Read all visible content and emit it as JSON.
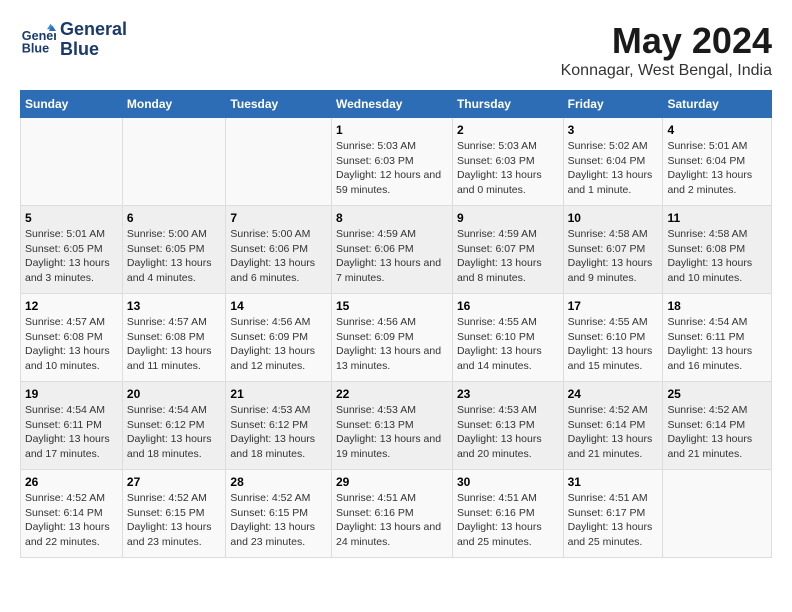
{
  "header": {
    "logo_line1": "General",
    "logo_line2": "Blue",
    "title": "May 2024",
    "subtitle": "Konnagar, West Bengal, India"
  },
  "weekdays": [
    "Sunday",
    "Monday",
    "Tuesday",
    "Wednesday",
    "Thursday",
    "Friday",
    "Saturday"
  ],
  "weeks": [
    [
      {
        "day": "",
        "info": ""
      },
      {
        "day": "",
        "info": ""
      },
      {
        "day": "",
        "info": ""
      },
      {
        "day": "1",
        "info": "Sunrise: 5:03 AM\nSunset: 6:03 PM\nDaylight: 12 hours\nand 59 minutes."
      },
      {
        "day": "2",
        "info": "Sunrise: 5:03 AM\nSunset: 6:03 PM\nDaylight: 13 hours\nand 0 minutes."
      },
      {
        "day": "3",
        "info": "Sunrise: 5:02 AM\nSunset: 6:04 PM\nDaylight: 13 hours\nand 1 minute."
      },
      {
        "day": "4",
        "info": "Sunrise: 5:01 AM\nSunset: 6:04 PM\nDaylight: 13 hours\nand 2 minutes."
      }
    ],
    [
      {
        "day": "5",
        "info": "Sunrise: 5:01 AM\nSunset: 6:05 PM\nDaylight: 13 hours\nand 3 minutes."
      },
      {
        "day": "6",
        "info": "Sunrise: 5:00 AM\nSunset: 6:05 PM\nDaylight: 13 hours\nand 4 minutes."
      },
      {
        "day": "7",
        "info": "Sunrise: 5:00 AM\nSunset: 6:06 PM\nDaylight: 13 hours\nand 6 minutes."
      },
      {
        "day": "8",
        "info": "Sunrise: 4:59 AM\nSunset: 6:06 PM\nDaylight: 13 hours\nand 7 minutes."
      },
      {
        "day": "9",
        "info": "Sunrise: 4:59 AM\nSunset: 6:07 PM\nDaylight: 13 hours\nand 8 minutes."
      },
      {
        "day": "10",
        "info": "Sunrise: 4:58 AM\nSunset: 6:07 PM\nDaylight: 13 hours\nand 9 minutes."
      },
      {
        "day": "11",
        "info": "Sunrise: 4:58 AM\nSunset: 6:08 PM\nDaylight: 13 hours\nand 10 minutes."
      }
    ],
    [
      {
        "day": "12",
        "info": "Sunrise: 4:57 AM\nSunset: 6:08 PM\nDaylight: 13 hours\nand 10 minutes."
      },
      {
        "day": "13",
        "info": "Sunrise: 4:57 AM\nSunset: 6:08 PM\nDaylight: 13 hours\nand 11 minutes."
      },
      {
        "day": "14",
        "info": "Sunrise: 4:56 AM\nSunset: 6:09 PM\nDaylight: 13 hours\nand 12 minutes."
      },
      {
        "day": "15",
        "info": "Sunrise: 4:56 AM\nSunset: 6:09 PM\nDaylight: 13 hours\nand 13 minutes."
      },
      {
        "day": "16",
        "info": "Sunrise: 4:55 AM\nSunset: 6:10 PM\nDaylight: 13 hours\nand 14 minutes."
      },
      {
        "day": "17",
        "info": "Sunrise: 4:55 AM\nSunset: 6:10 PM\nDaylight: 13 hours\nand 15 minutes."
      },
      {
        "day": "18",
        "info": "Sunrise: 4:54 AM\nSunset: 6:11 PM\nDaylight: 13 hours\nand 16 minutes."
      }
    ],
    [
      {
        "day": "19",
        "info": "Sunrise: 4:54 AM\nSunset: 6:11 PM\nDaylight: 13 hours\nand 17 minutes."
      },
      {
        "day": "20",
        "info": "Sunrise: 4:54 AM\nSunset: 6:12 PM\nDaylight: 13 hours\nand 18 minutes."
      },
      {
        "day": "21",
        "info": "Sunrise: 4:53 AM\nSunset: 6:12 PM\nDaylight: 13 hours\nand 18 minutes."
      },
      {
        "day": "22",
        "info": "Sunrise: 4:53 AM\nSunset: 6:13 PM\nDaylight: 13 hours\nand 19 minutes."
      },
      {
        "day": "23",
        "info": "Sunrise: 4:53 AM\nSunset: 6:13 PM\nDaylight: 13 hours\nand 20 minutes."
      },
      {
        "day": "24",
        "info": "Sunrise: 4:52 AM\nSunset: 6:14 PM\nDaylight: 13 hours\nand 21 minutes."
      },
      {
        "day": "25",
        "info": "Sunrise: 4:52 AM\nSunset: 6:14 PM\nDaylight: 13 hours\nand 21 minutes."
      }
    ],
    [
      {
        "day": "26",
        "info": "Sunrise: 4:52 AM\nSunset: 6:14 PM\nDaylight: 13 hours\nand 22 minutes."
      },
      {
        "day": "27",
        "info": "Sunrise: 4:52 AM\nSunset: 6:15 PM\nDaylight: 13 hours\nand 23 minutes."
      },
      {
        "day": "28",
        "info": "Sunrise: 4:52 AM\nSunset: 6:15 PM\nDaylight: 13 hours\nand 23 minutes."
      },
      {
        "day": "29",
        "info": "Sunrise: 4:51 AM\nSunset: 6:16 PM\nDaylight: 13 hours\nand 24 minutes."
      },
      {
        "day": "30",
        "info": "Sunrise: 4:51 AM\nSunset: 6:16 PM\nDaylight: 13 hours\nand 25 minutes."
      },
      {
        "day": "31",
        "info": "Sunrise: 4:51 AM\nSunset: 6:17 PM\nDaylight: 13 hours\nand 25 minutes."
      },
      {
        "day": "",
        "info": ""
      }
    ]
  ]
}
